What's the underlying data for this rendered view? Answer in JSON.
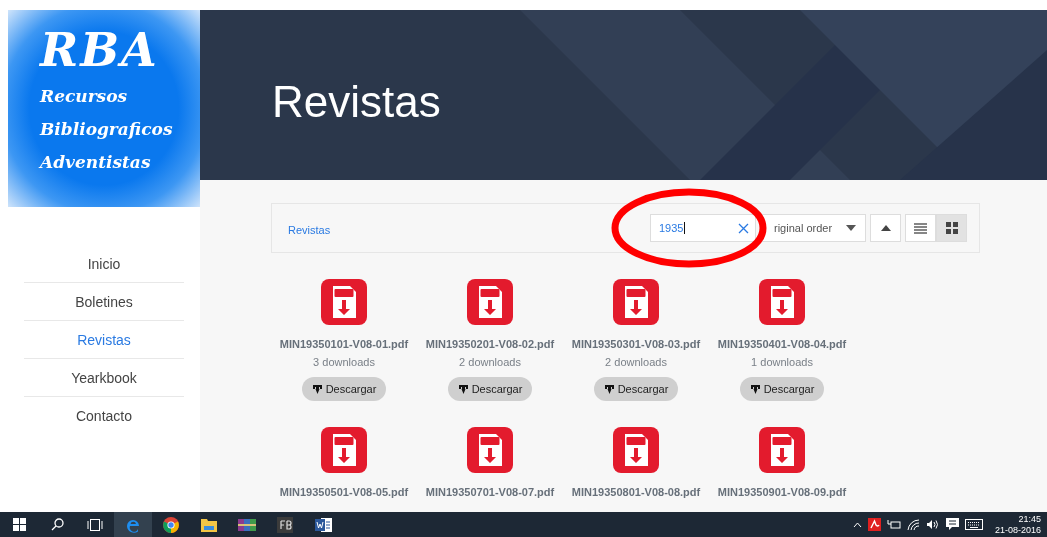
{
  "logo": {
    "title": "RBA",
    "lines": [
      "Recursos",
      "Bibliograficos",
      "Adventistas"
    ]
  },
  "nav": [
    {
      "label": "Inicio",
      "selected": false
    },
    {
      "label": "Boletines",
      "selected": false
    },
    {
      "label": "Revistas",
      "selected": true
    },
    {
      "label": "Yearkbook",
      "selected": false
    },
    {
      "label": "Contacto",
      "selected": false
    }
  ],
  "header": {
    "title": "Revistas"
  },
  "toolbar": {
    "breadcrumb": "Revistas",
    "search": {
      "value": "1935"
    },
    "sort": {
      "label": "riginal order"
    },
    "views": [
      {
        "kind": "list",
        "selected": false
      },
      {
        "kind": "grid",
        "selected": true
      }
    ]
  },
  "files": [
    {
      "name": "MIN19350101-V08-01.pdf",
      "downloads": "3 downloads",
      "button": "Descargar"
    },
    {
      "name": "MIN19350201-V08-02.pdf",
      "downloads": "2 downloads",
      "button": "Descargar"
    },
    {
      "name": "MIN19350301-V08-03.pdf",
      "downloads": "2 downloads",
      "button": "Descargar"
    },
    {
      "name": "MIN19350401-V08-04.pdf",
      "downloads": "1 downloads",
      "button": "Descargar"
    },
    {
      "name": "MIN19350501-V08-05.pdf"
    },
    {
      "name": "MIN19350701-V08-07.pdf"
    },
    {
      "name": "MIN19350801-V08-08.pdf"
    },
    {
      "name": "MIN19350901-V08-09.pdf"
    }
  ],
  "taskbar": {
    "apps": [
      {
        "kind": "start",
        "active": false
      },
      {
        "kind": "search",
        "active": false
      },
      {
        "kind": "taskview",
        "active": false
      },
      {
        "kind": "edge",
        "active": true
      },
      {
        "kind": "chrome",
        "active": false
      },
      {
        "kind": "explorer",
        "active": false
      },
      {
        "kind": "archive",
        "active": false
      },
      {
        "kind": "fb",
        "active": false
      },
      {
        "kind": "word",
        "active": false
      }
    ],
    "tray": [
      {
        "kind": "up"
      },
      {
        "kind": "antivirus"
      },
      {
        "kind": "battery"
      },
      {
        "kind": "wifi"
      },
      {
        "kind": "volume"
      },
      {
        "kind": "notification"
      },
      {
        "kind": "keyboard"
      }
    ],
    "time": "21:45",
    "date": "21-08-2016"
  }
}
